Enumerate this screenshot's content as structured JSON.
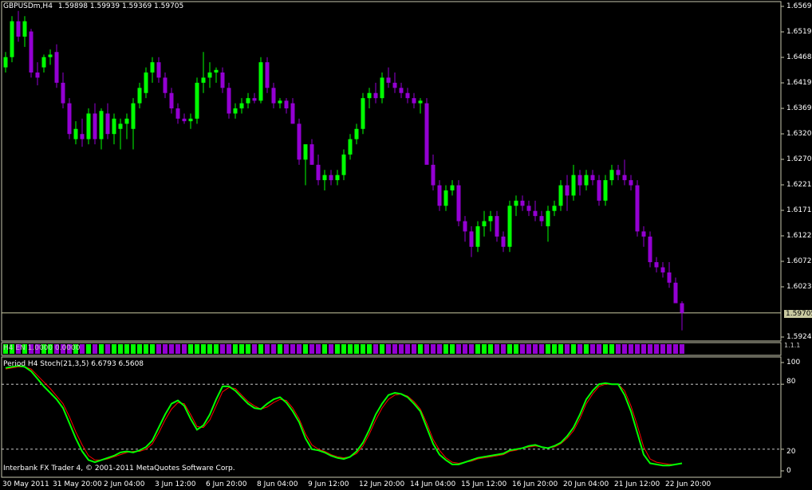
{
  "chart_header": {
    "symbol": "GBPUSDm,H4",
    "ohlc": "1.59898 1.59939 1.59369 1.59705"
  },
  "indicator_header": "H4 EN  1.0000  0.0000",
  "indicator_scale": "1.1.1",
  "stoch_header": "Period H4 Stoch(21,3,5) 6.6793 6.5608",
  "copyright": "Interbank FX Trader 4, © 2001-2011 MetaQuotes Software Corp.",
  "colors": {
    "background": "#000000",
    "axis": "#c8c8b0",
    "bull": "#00ff00",
    "bear": "#9400d3",
    "bid_line": "#c8c8a0",
    "stoch_main": "#00ff00",
    "stoch_signal": "#ff0000"
  },
  "price_axis": {
    "ticks": [
      "1.65690",
      "1.65190",
      "1.64689",
      "1.64190",
      "1.63690",
      "1.63200",
      "1.62700",
      "1.62210",
      "1.61710",
      "1.61220",
      "1.60725",
      "1.60230",
      "1.59240"
    ],
    "current_price": "1.59705"
  },
  "stoch_axis": {
    "ticks": [
      "100",
      "80",
      "20",
      "0"
    ]
  },
  "time_axis": {
    "labels": [
      "30 May 2011",
      "31 May 20:00",
      "2 Jun 04:00",
      "3 Jun 12:00",
      "6 Jun 20:00",
      "8 Jun 04:00",
      "9 Jun 12:00",
      "12 Jun 20:00",
      "14 Jun 04:00",
      "15 Jun 12:00",
      "16 Jun 20:00",
      "20 Jun 04:00",
      "21 Jun 12:00",
      "22 Jun 20:00"
    ]
  },
  "chart_data": [
    {
      "type": "candlestick",
      "title": "GBPUSDm,H4",
      "ylim": [
        1.5924,
        1.6569
      ],
      "candles": [
        [
          1.645,
          1.648,
          1.644,
          1.647
        ],
        [
          1.647,
          1.655,
          1.646,
          1.654
        ],
        [
          1.654,
          1.656,
          1.65,
          1.651
        ],
        [
          1.651,
          1.655,
          1.649,
          1.654
        ],
        [
          1.652,
          1.6525,
          1.643,
          1.644
        ],
        [
          1.644,
          1.646,
          1.6415,
          1.643
        ],
        [
          1.645,
          1.6475,
          1.644,
          1.647
        ],
        [
          1.647,
          1.6485,
          1.6455,
          1.6475
        ],
        [
          1.648,
          1.6495,
          1.641,
          1.642
        ],
        [
          1.642,
          1.644,
          1.637,
          1.638
        ],
        [
          1.638,
          1.639,
          1.631,
          1.632
        ],
        [
          1.631,
          1.6345,
          1.63,
          1.633
        ],
        [
          1.632,
          1.635,
          1.6295,
          1.631
        ],
        [
          1.631,
          1.637,
          1.63,
          1.636
        ],
        [
          1.636,
          1.638,
          1.63,
          1.631
        ],
        [
          1.631,
          1.637,
          1.629,
          1.6365
        ],
        [
          1.636,
          1.638,
          1.631,
          1.632
        ],
        [
          1.632,
          1.636,
          1.63,
          1.635
        ],
        [
          1.633,
          1.635,
          1.629,
          1.634
        ],
        [
          1.634,
          1.636,
          1.631,
          1.635
        ],
        [
          1.633,
          1.639,
          1.629,
          1.638
        ],
        [
          1.638,
          1.642,
          1.637,
          1.641
        ],
        [
          1.64,
          1.645,
          1.639,
          1.644
        ],
        [
          1.644,
          1.647,
          1.642,
          1.646
        ],
        [
          1.646,
          1.647,
          1.642,
          1.643
        ],
        [
          1.643,
          1.644,
          1.639,
          1.64
        ],
        [
          1.64,
          1.641,
          1.636,
          1.637
        ],
        [
          1.637,
          1.638,
          1.634,
          1.635
        ],
        [
          1.635,
          1.636,
          1.634,
          1.6345
        ],
        [
          1.6345,
          1.636,
          1.633,
          1.635
        ],
        [
          1.635,
          1.643,
          1.634,
          1.642
        ],
        [
          1.642,
          1.648,
          1.64,
          1.643
        ],
        [
          1.643,
          1.646,
          1.641,
          1.644
        ],
        [
          1.644,
          1.645,
          1.642,
          1.6445
        ],
        [
          1.644,
          1.645,
          1.64,
          1.641
        ],
        [
          1.641,
          1.642,
          1.635,
          1.636
        ],
        [
          1.636,
          1.638,
          1.635,
          1.637
        ],
        [
          1.637,
          1.639,
          1.636,
          1.638
        ],
        [
          1.638,
          1.64,
          1.637,
          1.639
        ],
        [
          1.639,
          1.64,
          1.638,
          1.6385
        ],
        [
          1.6385,
          1.647,
          1.638,
          1.646
        ],
        [
          1.646,
          1.647,
          1.64,
          1.641
        ],
        [
          1.641,
          1.642,
          1.637,
          1.638
        ],
        [
          1.638,
          1.639,
          1.637,
          1.6385
        ],
        [
          1.6385,
          1.639,
          1.636,
          1.637
        ],
        [
          1.638,
          1.639,
          1.634,
          1.634
        ],
        [
          1.634,
          1.635,
          1.626,
          1.627
        ],
        [
          1.627,
          1.629,
          1.622,
          1.63
        ],
        [
          1.63,
          1.631,
          1.626,
          1.626
        ],
        [
          1.626,
          1.628,
          1.622,
          1.623
        ],
        [
          1.623,
          1.625,
          1.621,
          1.624
        ],
        [
          1.624,
          1.625,
          1.622,
          1.623
        ],
        [
          1.623,
          1.625,
          1.622,
          1.624
        ],
        [
          1.624,
          1.629,
          1.623,
          1.628
        ],
        [
          1.628,
          1.632,
          1.627,
          1.631
        ],
        [
          1.631,
          1.634,
          1.63,
          1.633
        ],
        [
          1.633,
          1.64,
          1.632,
          1.639
        ],
        [
          1.639,
          1.641,
          1.637,
          1.64
        ],
        [
          1.64,
          1.642,
          1.638,
          1.639
        ],
        [
          1.639,
          1.644,
          1.638,
          1.643
        ],
        [
          1.643,
          1.645,
          1.641,
          1.642
        ],
        [
          1.642,
          1.644,
          1.64,
          1.641
        ],
        [
          1.641,
          1.642,
          1.639,
          1.64
        ],
        [
          1.64,
          1.641,
          1.638,
          1.639
        ],
        [
          1.639,
          1.64,
          1.637,
          1.638
        ],
        [
          1.638,
          1.639,
          1.636,
          1.6385
        ],
        [
          1.638,
          1.639,
          1.628,
          1.626
        ],
        [
          1.626,
          1.628,
          1.621,
          1.622
        ],
        [
          1.622,
          1.623,
          1.617,
          1.618
        ],
        [
          1.618,
          1.622,
          1.617,
          1.621
        ],
        [
          1.621,
          1.623,
          1.62,
          1.622
        ],
        [
          1.622,
          1.623,
          1.614,
          1.615
        ],
        [
          1.615,
          1.616,
          1.611,
          1.613
        ],
        [
          1.613,
          1.614,
          1.608,
          1.61
        ],
        [
          1.61,
          1.615,
          1.609,
          1.614
        ],
        [
          1.614,
          1.617,
          1.612,
          1.615
        ],
        [
          1.615,
          1.617,
          1.613,
          1.616
        ],
        [
          1.616,
          1.617,
          1.611,
          1.612
        ],
        [
          1.612,
          1.613,
          1.609,
          1.61
        ],
        [
          1.61,
          1.619,
          1.609,
          1.618
        ],
        [
          1.618,
          1.62,
          1.616,
          1.619
        ],
        [
          1.619,
          1.62,
          1.617,
          1.618
        ],
        [
          1.618,
          1.619,
          1.616,
          1.617
        ],
        [
          1.617,
          1.619,
          1.615,
          1.616
        ],
        [
          1.616,
          1.617,
          1.614,
          1.615
        ],
        [
          1.614,
          1.618,
          1.611,
          1.617
        ],
        [
          1.617,
          1.619,
          1.616,
          1.618
        ],
        [
          1.618,
          1.623,
          1.617,
          1.622
        ],
        [
          1.622,
          1.624,
          1.617,
          1.62
        ],
        [
          1.62,
          1.626,
          1.619,
          1.624
        ],
        [
          1.624,
          1.625,
          1.62,
          1.622
        ],
        [
          1.622,
          1.625,
          1.621,
          1.624
        ],
        [
          1.624,
          1.625,
          1.622,
          1.623
        ],
        [
          1.623,
          1.624,
          1.618,
          1.619
        ],
        [
          1.619,
          1.624,
          1.618,
          1.623
        ],
        [
          1.623,
          1.626,
          1.622,
          1.625
        ],
        [
          1.625,
          1.626,
          1.623,
          1.624
        ],
        [
          1.624,
          1.627,
          1.622,
          1.623
        ],
        [
          1.623,
          1.624,
          1.621,
          1.622
        ],
        [
          1.622,
          1.623,
          1.612,
          1.613
        ],
        [
          1.613,
          1.614,
          1.61,
          1.612
        ],
        [
          1.612,
          1.613,
          1.606,
          1.607
        ],
        [
          1.607,
          1.608,
          1.605,
          1.606
        ],
        [
          1.606,
          1.607,
          1.604,
          1.605
        ],
        [
          1.605,
          1.607,
          1.602,
          1.603
        ],
        [
          1.603,
          1.604,
          1.6,
          1.599
        ],
        [
          1.599,
          1.5994,
          1.5937,
          1.5971
        ]
      ]
    },
    {
      "type": "line",
      "title": "Period H4 Stoch(21,3,5) 6.6793 6.5608",
      "ylim": [
        0,
        100
      ],
      "levels": [
        20,
        80
      ],
      "series": [
        {
          "name": "Stoch(21,3,5) main",
          "values": [
            95,
            96,
            97,
            96,
            92,
            85,
            78,
            72,
            66,
            58,
            44,
            30,
            18,
            10,
            8,
            10,
            12,
            14,
            17,
            18,
            17,
            19,
            22,
            28,
            40,
            52,
            62,
            65,
            60,
            48,
            38,
            42,
            52,
            66,
            78,
            78,
            74,
            68,
            62,
            58,
            57,
            62,
            66,
            68,
            63,
            55,
            45,
            30,
            20,
            19,
            17,
            14,
            12,
            11,
            13,
            18,
            26,
            38,
            52,
            62,
            70,
            72,
            71,
            68,
            62,
            55,
            40,
            25,
            15,
            10,
            6,
            6,
            8,
            10,
            12,
            13,
            14,
            15,
            16,
            19,
            20,
            21,
            23,
            24,
            22,
            21,
            23,
            26,
            32,
            40,
            52,
            66,
            74,
            80,
            81,
            80,
            80,
            70,
            55,
            35,
            15,
            7,
            6,
            5,
            5,
            6,
            7
          ]
        },
        {
          "name": "Stoch(21,3,5) signal",
          "values": [
            94,
            95,
            96,
            96,
            94,
            88,
            82,
            76,
            69,
            62,
            50,
            36,
            24,
            14,
            10,
            10,
            11,
            13,
            15,
            17,
            18,
            18,
            20,
            25,
            35,
            47,
            57,
            63,
            62,
            52,
            41,
            40,
            47,
            60,
            73,
            77,
            76,
            70,
            64,
            60,
            57,
            59,
            63,
            66,
            65,
            58,
            48,
            34,
            24,
            20,
            18,
            15,
            13,
            12,
            13,
            16,
            23,
            34,
            47,
            58,
            66,
            70,
            71,
            69,
            64,
            57,
            44,
            29,
            19,
            12,
            8,
            7,
            8,
            9,
            11,
            12,
            13,
            14,
            15,
            18,
            19,
            21,
            22,
            23,
            22,
            21,
            22,
            25,
            30,
            37,
            48,
            62,
            71,
            78,
            80,
            80,
            80,
            74,
            60,
            42,
            22,
            11,
            8,
            7,
            6,
            6,
            7
          ]
        }
      ]
    }
  ]
}
